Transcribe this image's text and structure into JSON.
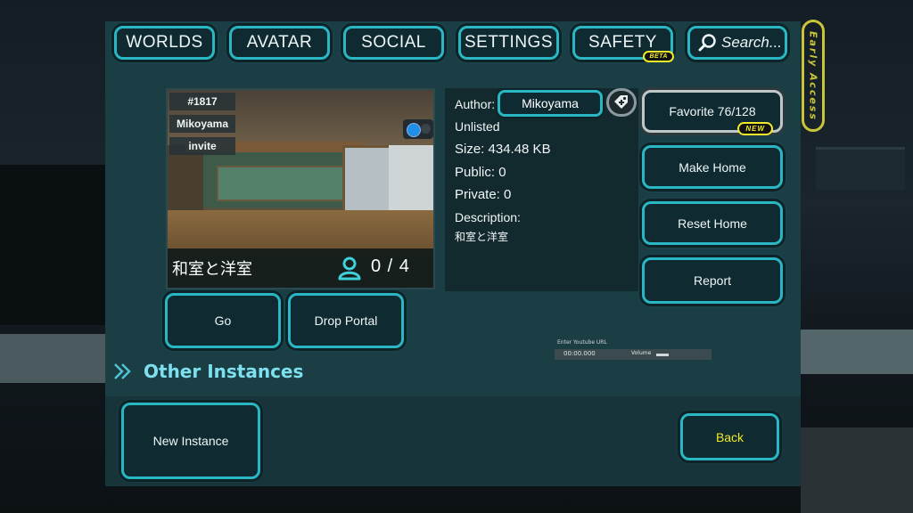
{
  "tabs": [
    {
      "label": "WORLDS"
    },
    {
      "label": "AVATAR"
    },
    {
      "label": "SOCIAL"
    },
    {
      "label": "SETTINGS"
    },
    {
      "label": "SAFETY",
      "badge": "BETA"
    }
  ],
  "search": {
    "label": "Search..."
  },
  "early_access": "Early Access",
  "thumbnail": {
    "instance_id": "#1817",
    "owner": "Mikoyama",
    "instance_type": "invite",
    "world_name": "和室と洋室",
    "player_count": "0 / 4"
  },
  "info": {
    "author_label": "Author:",
    "author_name": "Mikoyama",
    "visibility": "Unlisted",
    "size": "Size: 434.48 KB",
    "public": "Public: 0",
    "private": "Private: 0",
    "description_label": "Description:",
    "description": "和室と洋室"
  },
  "actions": {
    "favorite": "Favorite 76/128",
    "favorite_badge": "NEW",
    "make_home": "Make Home",
    "reset_home": "Reset Home",
    "report": "Report",
    "go": "Go",
    "drop_portal": "Drop Portal"
  },
  "other_instances": {
    "title": "Other Instances"
  },
  "bottom": {
    "new_instance": "New Instance",
    "back": "Back"
  },
  "youtube_overlay": {
    "url_label": "Enter Youtube URL",
    "time": "00:00.000",
    "volume_label": "Volume"
  },
  "colors": {
    "accent": "#29b7c4",
    "panel": "#1b3e45",
    "badge_yellow": "#f0ea2a",
    "back_text": "#f0ea2a",
    "section_title": "#7ee0ee"
  }
}
